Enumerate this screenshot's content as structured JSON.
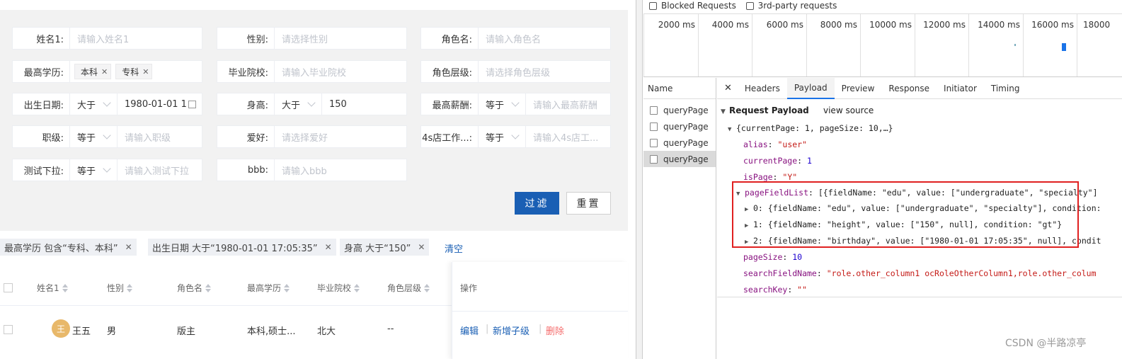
{
  "filters": {
    "name1": {
      "label": "姓名1:",
      "placeholder": "请输入姓名1"
    },
    "gender": {
      "label": "性别:",
      "placeholder": "请选择性别"
    },
    "role_name": {
      "label": "角色名:",
      "placeholder": "请输入角色名"
    },
    "education": {
      "label": "最高学历:",
      "tags": [
        "本科",
        "专科"
      ]
    },
    "school": {
      "label": "毕业院校:",
      "placeholder": "请输入毕业院校"
    },
    "role_level": {
      "label": "角色层级:",
      "placeholder": "请选择角色层级"
    },
    "birthday": {
      "label": "出生日期:",
      "op": "大于",
      "value": "1980-01-01 1"
    },
    "height": {
      "label": "身高:",
      "op": "大于",
      "value": "150"
    },
    "salary": {
      "label": "最高薪酬:",
      "op": "等于",
      "placeholder": "请输入最高薪酬"
    },
    "position": {
      "label": "职级:",
      "op": "等于",
      "placeholder": "请输入职级"
    },
    "hobby": {
      "label": "爱好:",
      "placeholder": "请选择爱好"
    },
    "shop": {
      "label": "4s店工作...:",
      "op": "等于",
      "placeholder": "请输入4s店工..."
    },
    "test_dropdown": {
      "label": "测试下拉:",
      "op": "等于",
      "placeholder": "请输入测试下拉"
    },
    "bbb": {
      "label": "bbb:",
      "placeholder": "请输入bbb"
    }
  },
  "buttons": {
    "filter": "过滤",
    "reset": "重置"
  },
  "conditions": [
    "最高学历 包含“专科、本科”",
    "出生日期 大于“1980-01-01 17:05:35”",
    "身高 大于“150”"
  ],
  "clear_label": "清空",
  "table": {
    "headers": [
      "姓名1",
      "性别",
      "角色名",
      "最高学历",
      "毕业院校",
      "角色层级",
      "操作"
    ],
    "row": {
      "avatar": "王",
      "name": "王五",
      "gender": "男",
      "role": "版主",
      "education": "本科,硕士...",
      "school": "北大",
      "level": "--"
    },
    "actions": [
      "编辑",
      "新增子级",
      "删除"
    ]
  },
  "devtools": {
    "blocked_requests": "Blocked Requests",
    "third_party": "3rd-party requests",
    "timeline_ticks": [
      "2000 ms",
      "4000 ms",
      "6000 ms",
      "8000 ms",
      "10000 ms",
      "12000 ms",
      "14000 ms",
      "16000 ms",
      "18000"
    ],
    "name_header": "Name",
    "requests": [
      "queryPage",
      "queryPage",
      "queryPage",
      "queryPage"
    ],
    "tabs": [
      "Headers",
      "Payload",
      "Preview",
      "Response",
      "Initiator",
      "Timing"
    ],
    "active_tab": "Payload",
    "payload_title": "Request Payload",
    "view_source": "view source",
    "lines": {
      "root": "{currentPage: 1, pageSize: 10,…}",
      "alias_k": "alias",
      "alias_v": "\"user\"",
      "cp_k": "currentPage",
      "cp_v": "1",
      "isPage_k": "isPage",
      "isPage_v": "\"Y\"",
      "pfl_k": "pageFieldList",
      "pfl_v": "[{fieldName: \"edu\", value: [\"undergraduate\", \"specialty\"]",
      "item0": "0: {fieldName: \"edu\", value: [\"undergraduate\", \"specialty\"], condition:",
      "item1": "1: {fieldName: \"height\", value: [\"150\", null], condition: \"gt\"}",
      "item2": "2: {fieldName: \"birthday\", value: [\"1980-01-01 17:05:35\", null], condit",
      "ps_k": "pageSize",
      "ps_v": "10",
      "sfn_k": "searchFieldName",
      "sfn_v": "\"role.other_column1 ocRoleOtherColumn1,role.other_colum",
      "sk_k": "searchKey",
      "sk_v": "\"\""
    }
  },
  "watermark": "CSDN @半路凉亭",
  "colors": {
    "primary": "#1a5fb4",
    "highlight_box": "#e02020",
    "danger": "#f56c6c"
  }
}
